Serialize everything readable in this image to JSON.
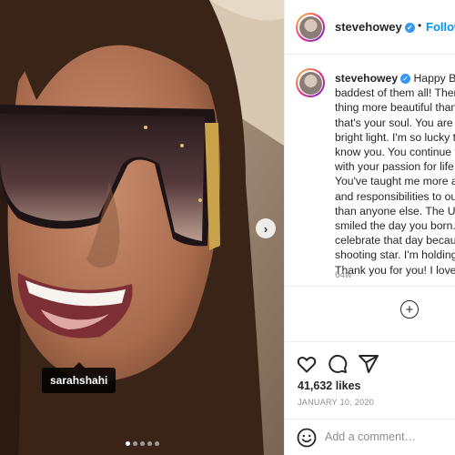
{
  "photo": {
    "tagged_user": "sarahshahi",
    "carousel_dot_count": 5,
    "carousel_active_index": 0,
    "next_icon": "chevron-right-icon"
  },
  "post": {
    "username": "stevehowey",
    "verified_icon": "verified-badge-icon",
    "follow_label": "Follow",
    "header_separator": "•",
    "caption_lines": [
      "Happy Birt",
      "baddest of them all! There",
      "thing more beautiful than",
      "that's your soul. You are t",
      "bright light. I'm so lucky t",
      "know you. You continue t",
      "with your passion for life",
      "You've taught me more al",
      "and responsibilities to ou",
      "than anyone else. The Un",
      "smiled the day you born.",
      "celebrate that day becaus",
      "shooting star. I'm holding",
      "Thank you for you! I love"
    ],
    "caption_time": "64w",
    "add_icon_label": "+",
    "likes": "41,632 likes",
    "date": "JANUARY 10, 2020"
  },
  "actions": {
    "like_icon": "heart-icon",
    "comment_icon": "comment-icon",
    "share_icon": "share-icon"
  },
  "comment": {
    "emoji_icon": "emoji-icon",
    "placeholder": "Add a comment…"
  },
  "colors": {
    "accent": "#0095f6",
    "verified": "#3897f0",
    "text": "#262626",
    "muted": "#8e8e8e"
  }
}
